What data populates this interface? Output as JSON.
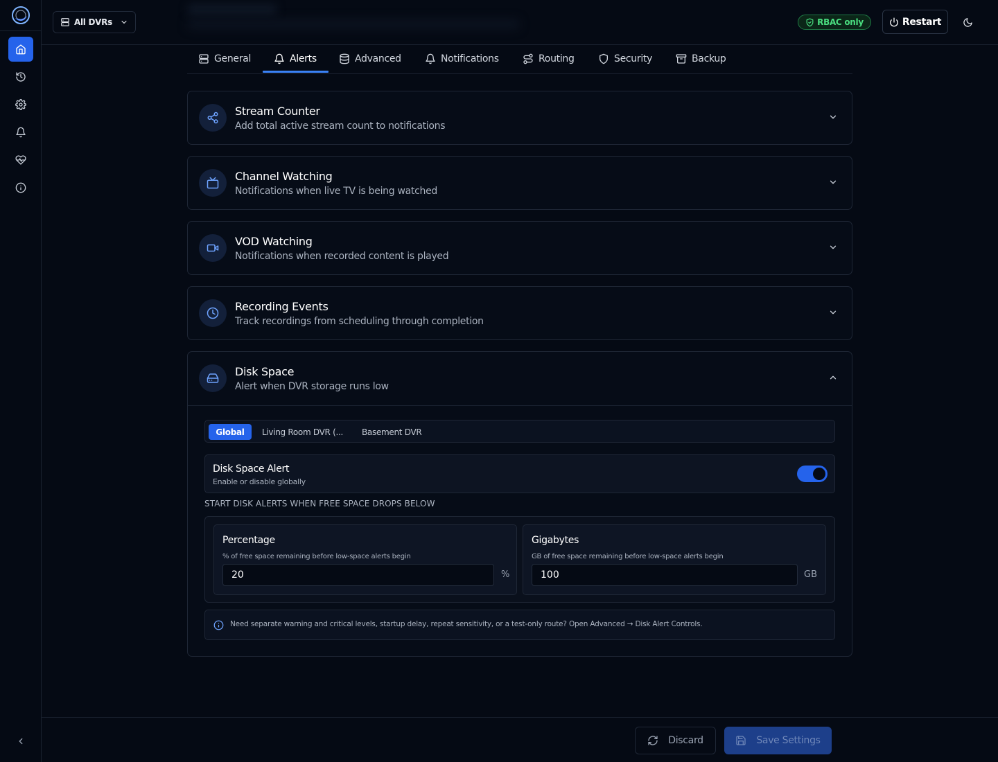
{
  "topbar": {
    "dvr_select_label": "All DVRs",
    "rbac_badge": "RBAC only",
    "restart_label": "Restart"
  },
  "sidebar": {
    "items": [
      {
        "name": "home",
        "icon": "home-icon",
        "active": true
      },
      {
        "name": "history",
        "icon": "history-icon",
        "active": false
      },
      {
        "name": "settings",
        "icon": "gear-icon",
        "active": false
      },
      {
        "name": "alerts",
        "icon": "bell-icon",
        "active": false
      },
      {
        "name": "health",
        "icon": "heart-pulse-icon",
        "active": false
      },
      {
        "name": "about",
        "icon": "info-icon",
        "active": false
      }
    ]
  },
  "tabs": [
    {
      "label": "General",
      "icon": "server-icon"
    },
    {
      "label": "Alerts",
      "icon": "bell-icon",
      "active": true
    },
    {
      "label": "Advanced",
      "icon": "database-icon"
    },
    {
      "label": "Notifications",
      "icon": "bell-icon"
    },
    {
      "label": "Routing",
      "icon": "route-icon"
    },
    {
      "label": "Security",
      "icon": "shield-icon"
    },
    {
      "label": "Backup",
      "icon": "archive-icon"
    }
  ],
  "panels": [
    {
      "title": "Stream Counter",
      "subtitle": "Add total active stream count to notifications",
      "icon": "share-icon",
      "expanded": false
    },
    {
      "title": "Channel Watching",
      "subtitle": "Notifications when live TV is being watched",
      "icon": "tv-icon",
      "expanded": false
    },
    {
      "title": "VOD Watching",
      "subtitle": "Notifications when recorded content is played",
      "icon": "video-icon",
      "expanded": false
    },
    {
      "title": "Recording Events",
      "subtitle": "Track recordings from scheduling through completion",
      "icon": "clock-icon",
      "expanded": false
    },
    {
      "title": "Disk Space",
      "subtitle": "Alert when DVR storage runs low",
      "icon": "hard-drive-icon",
      "expanded": true
    }
  ],
  "disk": {
    "scopes": [
      "Global",
      "Living Room DVR (...",
      "Basement DVR"
    ],
    "toggle_title": "Disk Space Alert",
    "toggle_subtitle": "Enable or disable globally",
    "toggle_on": true,
    "section_label": "START DISK ALERTS WHEN FREE SPACE DROPS BELOW",
    "percentage": {
      "title": "Percentage",
      "subtitle": "% of free space remaining before low-space alerts begin",
      "value": "20",
      "unit": "%"
    },
    "gigabytes": {
      "title": "Gigabytes",
      "subtitle": "GB of free space remaining before low-space alerts begin",
      "value": "100",
      "unit": "GB"
    },
    "info_text": "Need separate warning and critical levels, startup delay, repeat sensitivity, or a test-only route? Open Advanced → Disk Alert Controls."
  },
  "footer": {
    "discard_label": "Discard",
    "save_label": "Save Settings"
  },
  "colors": {
    "accent": "#2563eb",
    "background": "#050a14",
    "success": "#4ade80"
  }
}
